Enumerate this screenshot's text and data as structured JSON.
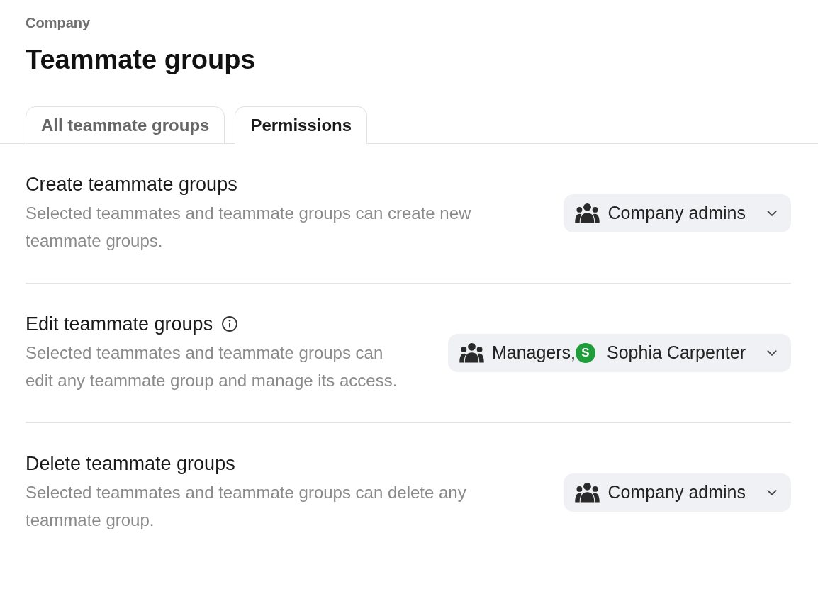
{
  "breadcrumb": "Company",
  "title": "Teammate groups",
  "tabs": [
    {
      "label": "All teammate groups",
      "selected": false
    },
    {
      "label": "Permissions",
      "selected": true
    }
  ],
  "permissions": [
    {
      "title": "Create teammate groups",
      "has_info": false,
      "description": "Selected teammates and teammate groups can create new teammate groups.",
      "selector": [
        {
          "kind": "group",
          "label": "Company admins"
        }
      ]
    },
    {
      "title": "Edit teammate groups",
      "has_info": true,
      "description": "Selected teammates and teammate groups can edit any teammate group and manage its access.",
      "selector": [
        {
          "kind": "group",
          "label": "Managers,"
        },
        {
          "kind": "person",
          "initial": "S",
          "color": "#1f9d3a",
          "label": "Sophia Carpenter"
        }
      ]
    },
    {
      "title": "Delete teammate groups",
      "has_info": false,
      "description": "Selected teammates and teammate groups can delete any teammate group.",
      "selector": [
        {
          "kind": "group",
          "label": "Company admins"
        }
      ]
    }
  ]
}
